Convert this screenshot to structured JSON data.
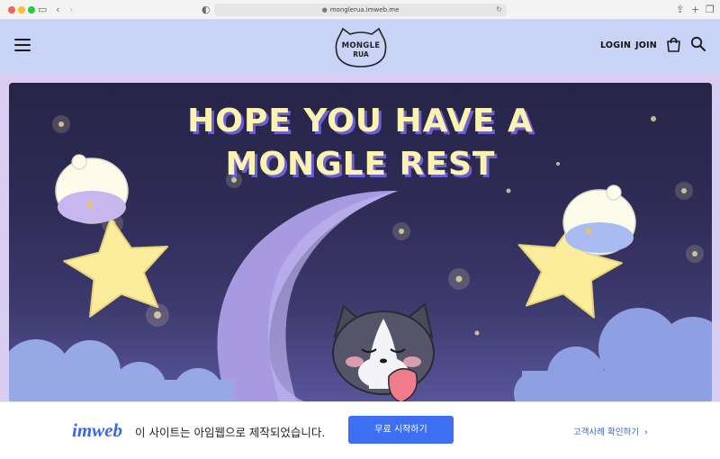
{
  "browser": {
    "url": "monglerua.imweb.me",
    "icons": [
      "sidebar-icon",
      "back-icon",
      "forward-icon",
      "privacy-icon",
      "lock-icon",
      "reload-icon",
      "share-icon",
      "new-tab-icon",
      "tabs-icon"
    ]
  },
  "header": {
    "logo_line1": "MONGLE",
    "logo_line2": "RUA",
    "nav": {
      "login": "LOGIN",
      "join": "JOIN"
    },
    "colors": {
      "background": "#c9d3f6"
    }
  },
  "hero": {
    "title_line1": "HOPE YOU HAVE A",
    "title_line2": "MONGLE REST",
    "colors": {
      "title": "#fdf3b0",
      "title_shadow": "#6d5fd6",
      "sky_top": "#262446",
      "sky_bottom": "#58569a",
      "moon": "#a89be0",
      "star": "#fbed9b",
      "cloud": "#97a8e6"
    }
  },
  "imweb_bar": {
    "logo": "imweb",
    "message": "이 사이트는 아임웹으로 제작되었습니다.",
    "button": "무료 시작하기",
    "link": "고객사례 확인하기",
    "link_icon": "chevron-right-icon",
    "colors": {
      "accent": "#3c6ff1"
    }
  }
}
